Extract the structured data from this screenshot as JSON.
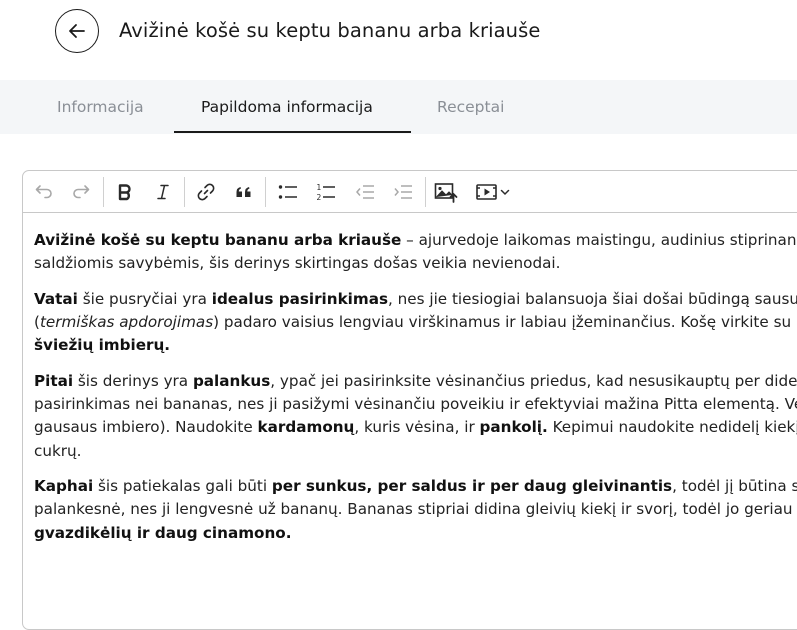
{
  "header": {
    "back_label": "",
    "title": "Avižinė košė su keptu bananu arba kriauše"
  },
  "tabs": [
    {
      "label": "Informacija",
      "active": false
    },
    {
      "label": "Papildoma informacija",
      "active": true
    },
    {
      "label": "Receptai",
      "active": false
    }
  ],
  "toolbar": {
    "buttons": [
      "undo-icon",
      "redo-icon",
      "bold-icon",
      "italic-icon",
      "link-icon",
      "blockquote-icon",
      "bulleted-list-icon",
      "numbered-list-icon",
      "outdent-icon",
      "indent-icon",
      "insert-image-icon",
      "insert-media-icon",
      "chevron-down-icon"
    ]
  },
  "content": {
    "p1": {
      "l1": {
        "b1": "Avižinė košė su keptu bananu arba kriauše",
        "t1": " – ajurvedoje laikomas maistingu, audinius stiprinančiu"
      },
      "l2": {
        "t1": "saldžiomis savybėmis, šis derinys skirtingas došas veikia nevienodai."
      }
    },
    "p2": {
      "l1": {
        "b1": "Vatai",
        "t1": " šie pusryčiai yra ",
        "b2": "idealus pasirinkimas",
        "t2": ", nes jie tiesiogiai balansuoja šiai došai būdingą sausumą"
      },
      "l2": {
        "t1": "(",
        "i1": "termiškas apdorojimas",
        "t2": ") padaro vaisius lengviau virškinamus ir labiau įžeminančius. Košę virkite su"
      },
      "l3": {
        "b1": "šviežių imbierų."
      }
    },
    "p3": {
      "l1": {
        "b1": "Pitai",
        "t1": " šis derinys yra ",
        "b2": "palankus",
        "t2": ", ypač jei pasirinksite vėsinančius priedus, kad nesusikauptų per didelis"
      },
      "l2": {
        "t1": "pasirinkimas nei bananas, nes ji pasižymi vėsinančiu poveikiu ir efektyviai mažina Pitta elementą. Venkite"
      },
      "l3": {
        "t1": "gausaus imbiero). Naudokite ",
        "b1": "kardamonų",
        "t2": ", kuris vėsina, ir ",
        "b2": "pankolį.",
        "t3": " Kepimui naudokite nedidelį kiekį"
      },
      "l4": {
        "t1": "cukrų."
      }
    },
    "p4": {
      "l1": {
        "b1": "Kaphai",
        "t1": " šis patiekalas gali būti ",
        "b2": "per sunkus, per saldus ir per daug gleivinantis",
        "t2": ", todėl jį būtina stiprinti."
      },
      "l2": {
        "t1": "palankesnė, nes ji lengvesnė už bananų. Bananas stipriai didina gleivių kiekį ir svorį, todėl jo geriau"
      },
      "l3": {
        "b1": "gvazdikėlių ir daug cinamono."
      }
    }
  }
}
